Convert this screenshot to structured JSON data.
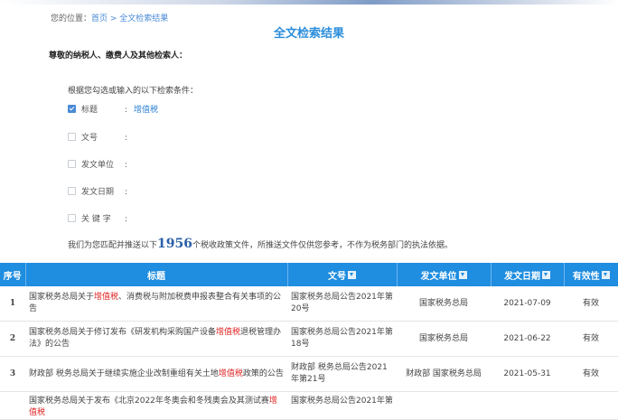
{
  "location": {
    "prefix": "您的位置：",
    "home": "首页",
    "sep": " > ",
    "current": "全文检索结果"
  },
  "page_title": "全文检索结果",
  "greeting": "尊敬的纳税人、缴费人及其他检索人：",
  "conditions_intro": "根据您勾选或输入的以下检索条件：",
  "conditions": [
    {
      "label": "标题",
      "checked": true,
      "value": "增值税"
    },
    {
      "label": "文号",
      "checked": false,
      "value": ""
    },
    {
      "label": "发文单位",
      "checked": false,
      "value": ""
    },
    {
      "label": "发文日期",
      "checked": false,
      "value": ""
    },
    {
      "label": "关 键 字",
      "checked": false,
      "value": ""
    }
  ],
  "notice": {
    "before": "我们为您匹配并推送以下",
    "count": "1956",
    "after": "个税收政策文件，所推送文件仅供您参考，不作为税务部门的执法依据。"
  },
  "table": {
    "headers": {
      "index": "序号",
      "title": "标题",
      "doc_no": "文号",
      "issuer": "发文单位",
      "date": "发文日期",
      "validity": "有效性"
    },
    "rows": [
      {
        "index": "1",
        "title_pre": "国家税务总局关于",
        "title_hl": "增值税",
        "title_post": "、消费税与附加税费申报表整合有关事项的公告",
        "doc_no": "国家税务总局公告2021年第20号",
        "issuer": "国家税务总局",
        "date": "2021-07-09",
        "validity": "有效"
      },
      {
        "index": "2",
        "title_pre": "国家税务总局关于修订发布《研发机构采购国产设备",
        "title_hl": "增值税",
        "title_post": "退税管理办法》的公告",
        "doc_no": "国家税务总局公告2021年第18号",
        "issuer": "国家税务总局",
        "date": "2021-06-22",
        "validity": "有效"
      },
      {
        "index": "3",
        "title_pre": "财政部 税务总局关于继续实施企业改制重组有关土地",
        "title_hl": "增值税",
        "title_post": "政策的公告",
        "doc_no": "财政部 税务总局公告2021年第21号",
        "issuer": "财政部 国家税务总局",
        "date": "2021-05-31",
        "validity": "有效"
      },
      {
        "index": "",
        "title_pre": "国家税务总局关于发布《北京2022年冬奥会和冬残奥会及其测试赛",
        "title_hl": "增值税",
        "title_post": "",
        "doc_no": "国家税务总局公告2021年第",
        "issuer": "",
        "date": "",
        "validity": ""
      }
    ]
  },
  "colors": {
    "accent": "#1f8de0",
    "highlight": "#e02020",
    "link": "#4a8ad6"
  }
}
